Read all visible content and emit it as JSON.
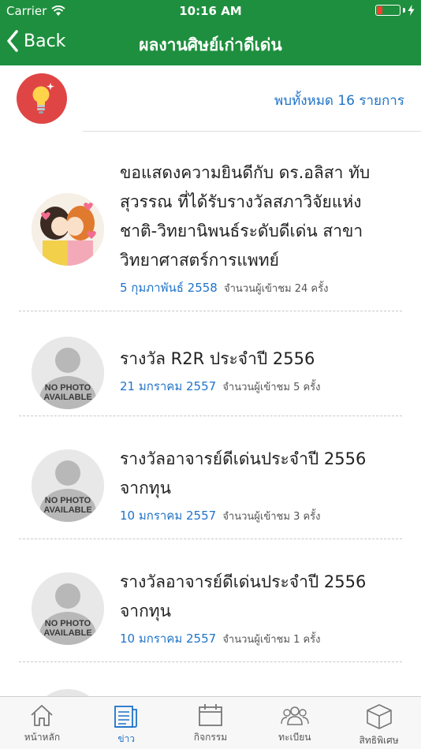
{
  "status_bar": {
    "carrier": "Carrier",
    "time": "10:16 AM",
    "battery_level": 0.25,
    "battery_color": "#ff3b30"
  },
  "nav": {
    "back_label": "Back",
    "title": "ผลงานศิษย์เก่าดีเด่น"
  },
  "summary": {
    "icon": "lightbulb-icon",
    "icon_bg": "#e04545",
    "text": "พบทั้งหมด 16 รายการ"
  },
  "news": [
    {
      "thumbnail": "cartoon-couple-image",
      "title": "ขอแสดงความยินดีกับ ดร.อลิสา ทับสุวรรณ ที่ได้รับรางวัลสภาวิจัยแห่งชาติ-วิทยานิพนธ์ระดับดีเด่น สาขาวิทยาศาสตร์การแพทย์",
      "title_lines": [
        "ขอแสดงความยินดีกับ ดร.อลิสา ทับ",
        "สุวรรณ ที่ได้รับรางวัลสภาวิจัยแห่ง",
        "ชาติ-วิทยานิพนธ์ระดับดีเด่น สาขา",
        "วิทยาศาสตร์การแพทย์"
      ],
      "date": "5 กุมภาพันธ์ 2558",
      "views": "จำนวนผู้เข้าชม 24 ครั้ง"
    },
    {
      "thumbnail": "no-photo",
      "title_lines": [
        "รางวัล R2R ประจำปี 2556"
      ],
      "date": "21 มกราคม 2557",
      "views": "จำนวนผู้เข้าชม 5 ครั้ง"
    },
    {
      "thumbnail": "no-photo",
      "title_lines": [
        "รางวัลอาจารย์ดีเด่นประจำปี 2556",
        "จากทุน"
      ],
      "date": "10 มกราคม 2557",
      "views": "จำนวนผู้เข้าชม 3 ครั้ง"
    },
    {
      "thumbnail": "no-photo",
      "title_lines": [
        "รางวัลอาจารย์ดีเด่นประจำปี 2556",
        "จากทุน"
      ],
      "date": "10 มกราคม 2557",
      "views": "จำนวนผู้เข้าชม 1 ครั้ง"
    }
  ],
  "no_photo_text": [
    "NO PHOTO",
    "AVAILABLE"
  ],
  "tabs": [
    {
      "label": "หน้าหลัก",
      "icon": "home-icon",
      "active": false
    },
    {
      "label": "ข่าว",
      "icon": "news-icon",
      "active": true
    },
    {
      "label": "กิจกรรม",
      "icon": "calendar-icon",
      "active": false
    },
    {
      "label": "ทะเบียน",
      "icon": "people-icon",
      "active": false
    },
    {
      "label": "สิทธิพิเศษ",
      "icon": "box-icon",
      "active": false
    }
  ],
  "colors": {
    "primary_green": "#1e8f3e",
    "link_blue": "#1f73c9"
  }
}
